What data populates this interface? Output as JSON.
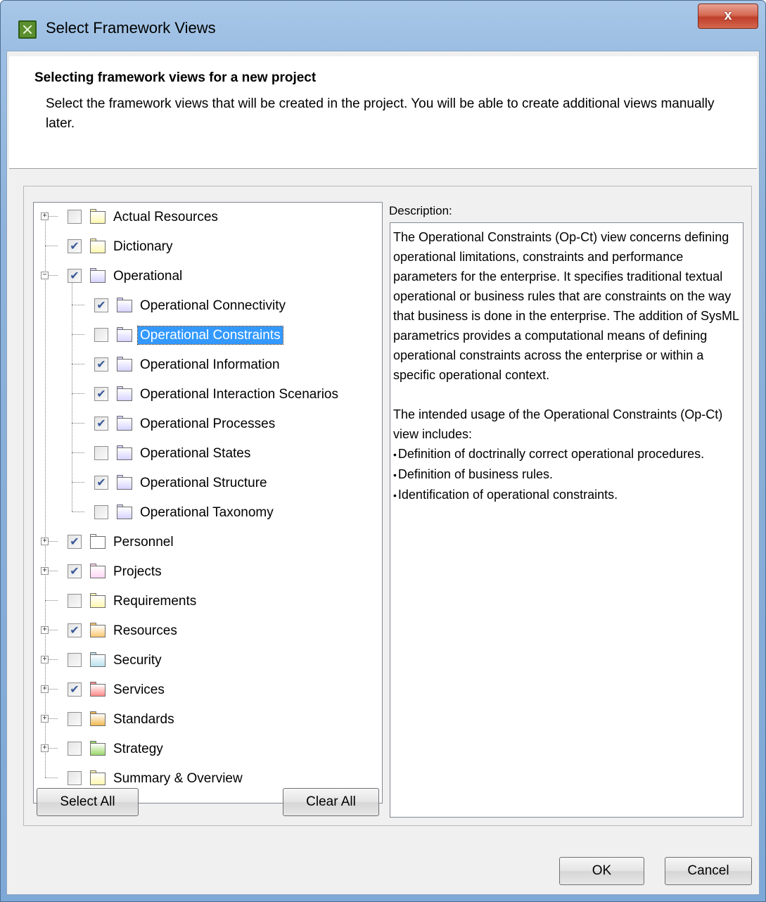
{
  "window": {
    "title": "Select Framework Views",
    "close_label": "x"
  },
  "header": {
    "title": "Selecting framework views for a new project",
    "description": "Select the framework views that will be created in the project. You will be able to create additional views manually later."
  },
  "tree": {
    "items": [
      {
        "label": "Actual Resources",
        "checked": false,
        "expandable": true,
        "expanded": false,
        "level": 0,
        "folder_color": "#fff7b0"
      },
      {
        "label": "Dictionary",
        "checked": true,
        "expandable": false,
        "level": 0,
        "folder_color": "#fff7b0"
      },
      {
        "label": "Operational",
        "checked": true,
        "expandable": true,
        "expanded": true,
        "level": 0,
        "folder_color": "#d6d3ff"
      },
      {
        "label": "Operational Connectivity",
        "checked": true,
        "expandable": false,
        "level": 1,
        "folder_color": "#d6d3ff"
      },
      {
        "label": "Operational Constraints",
        "checked": false,
        "expandable": false,
        "level": 1,
        "folder_color": "#d6d3ff",
        "selected": true
      },
      {
        "label": "Operational Information",
        "checked": true,
        "expandable": false,
        "level": 1,
        "folder_color": "#d6d3ff"
      },
      {
        "label": "Operational Interaction Scenarios",
        "checked": true,
        "expandable": false,
        "level": 1,
        "folder_color": "#d6d3ff"
      },
      {
        "label": "Operational Processes",
        "checked": true,
        "expandable": false,
        "level": 1,
        "folder_color": "#d6d3ff"
      },
      {
        "label": "Operational States",
        "checked": false,
        "expandable": false,
        "level": 1,
        "folder_color": "#d6d3ff"
      },
      {
        "label": "Operational Structure",
        "checked": true,
        "expandable": false,
        "level": 1,
        "folder_color": "#d6d3ff"
      },
      {
        "label": "Operational Taxonomy",
        "checked": false,
        "expandable": false,
        "level": 1,
        "folder_color": "#d6d3ff"
      },
      {
        "label": "Personnel",
        "checked": true,
        "expandable": true,
        "expanded": false,
        "level": 0,
        "folder_color": "#ffffff"
      },
      {
        "label": "Projects",
        "checked": true,
        "expandable": true,
        "expanded": false,
        "level": 0,
        "folder_color": "#ffd6f2"
      },
      {
        "label": "Requirements",
        "checked": false,
        "expandable": false,
        "level": 0,
        "folder_color": "#fff7b0"
      },
      {
        "label": "Resources",
        "checked": true,
        "expandable": true,
        "expanded": false,
        "level": 0,
        "folder_color": "#ffc870"
      },
      {
        "label": "Security",
        "checked": false,
        "expandable": true,
        "expanded": false,
        "level": 0,
        "folder_color": "#b8e0ec"
      },
      {
        "label": "Services",
        "checked": true,
        "expandable": true,
        "expanded": false,
        "level": 0,
        "folder_color": "#ff8a8a"
      },
      {
        "label": "Standards",
        "checked": false,
        "expandable": true,
        "expanded": false,
        "level": 0,
        "folder_color": "#f0b850"
      },
      {
        "label": "Strategy",
        "checked": false,
        "expandable": true,
        "expanded": false,
        "level": 0,
        "folder_color": "#9ad86a"
      },
      {
        "label": "Summary & Overview",
        "checked": false,
        "expandable": false,
        "level": 0,
        "folder_color": "#fff7b0"
      }
    ]
  },
  "buttons": {
    "select_all": "Select All",
    "clear_all": "Clear All",
    "ok": "OK",
    "cancel": "Cancel"
  },
  "description": {
    "label": "Description:",
    "paragraph1": "The Operational Constraints (Op-Ct) view concerns defining operational limitations, constraints and performance parameters for the enterprise. It specifies traditional textual operational or business rules that are constraints on the way that business is done in the enterprise. The addition of SysML parametrics provides a computational means of defining operational constraints across the enterprise or within a specific operational context.",
    "paragraph2": "The intended usage of the Operational Constraints (Op-Ct) view includes:",
    "bullets": [
      "Definition of doctrinally correct operational procedures.",
      "Definition of business rules.",
      "Identification of operational constraints."
    ]
  }
}
